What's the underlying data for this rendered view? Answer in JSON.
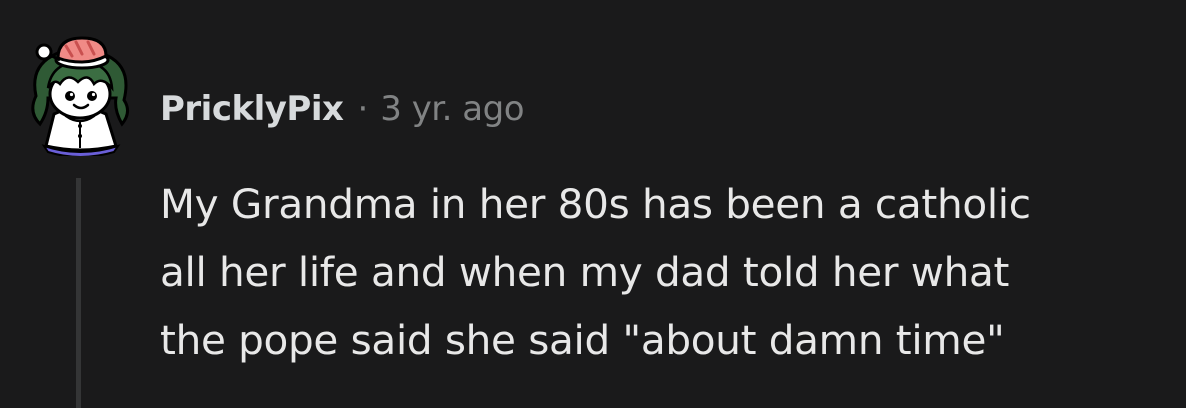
{
  "comment": {
    "author": "PricklyPix",
    "separator": "·",
    "time": "3 yr. ago",
    "avatar_icon": "snoo-avatar-icon",
    "body_lines": [
      "My Grandma in her 80s has been a catholic",
      "all her life and when my dad told her what",
      "the pope said she said \"about damn time\""
    ]
  },
  "colors": {
    "background": "#1a1a1b",
    "text": "#e8e8e8",
    "meta_text": "#818384",
    "thread_line": "#343536"
  }
}
